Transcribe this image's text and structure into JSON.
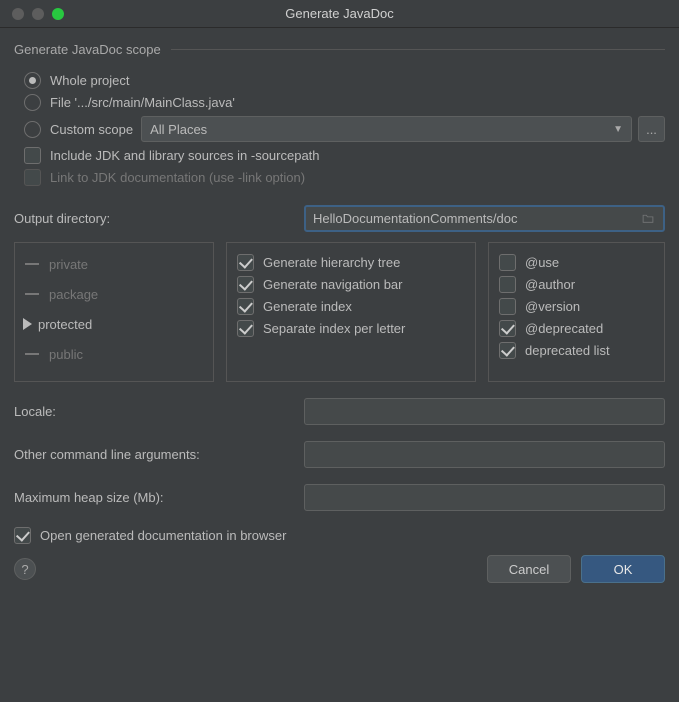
{
  "titlebar": {
    "title": "Generate JavaDoc"
  },
  "scope": {
    "legend": "Generate JavaDoc scope",
    "whole_project": "Whole project",
    "file_option": "File '.../src/main/MainClass.java'",
    "custom_scope": "Custom scope",
    "custom_scope_value": "All Places",
    "ellipsis": "...",
    "include_jdk": "Include JDK and library sources in -sourcepath",
    "link_jdk": "Link to JDK documentation (use -link option)"
  },
  "output": {
    "label": "Output directory:",
    "value": "HelloDocumentationComments/doc"
  },
  "visibility": {
    "private": "private",
    "package": "package",
    "protected": "protected",
    "public": "public"
  },
  "gen_opts": {
    "hierarchy": "Generate hierarchy tree",
    "navbar": "Generate navigation bar",
    "index": "Generate index",
    "sep_index": "Separate index per letter"
  },
  "tags": {
    "use": "@use",
    "author": "@author",
    "version": "@version",
    "deprecated": "@deprecated",
    "deprecated_list": "deprecated list"
  },
  "form": {
    "locale": "Locale:",
    "other_args": "Other command line arguments:",
    "heap": "Maximum heap size (Mb):",
    "open_browser": "Open generated documentation in browser"
  },
  "footer": {
    "help": "?",
    "cancel": "Cancel",
    "ok": "OK"
  }
}
